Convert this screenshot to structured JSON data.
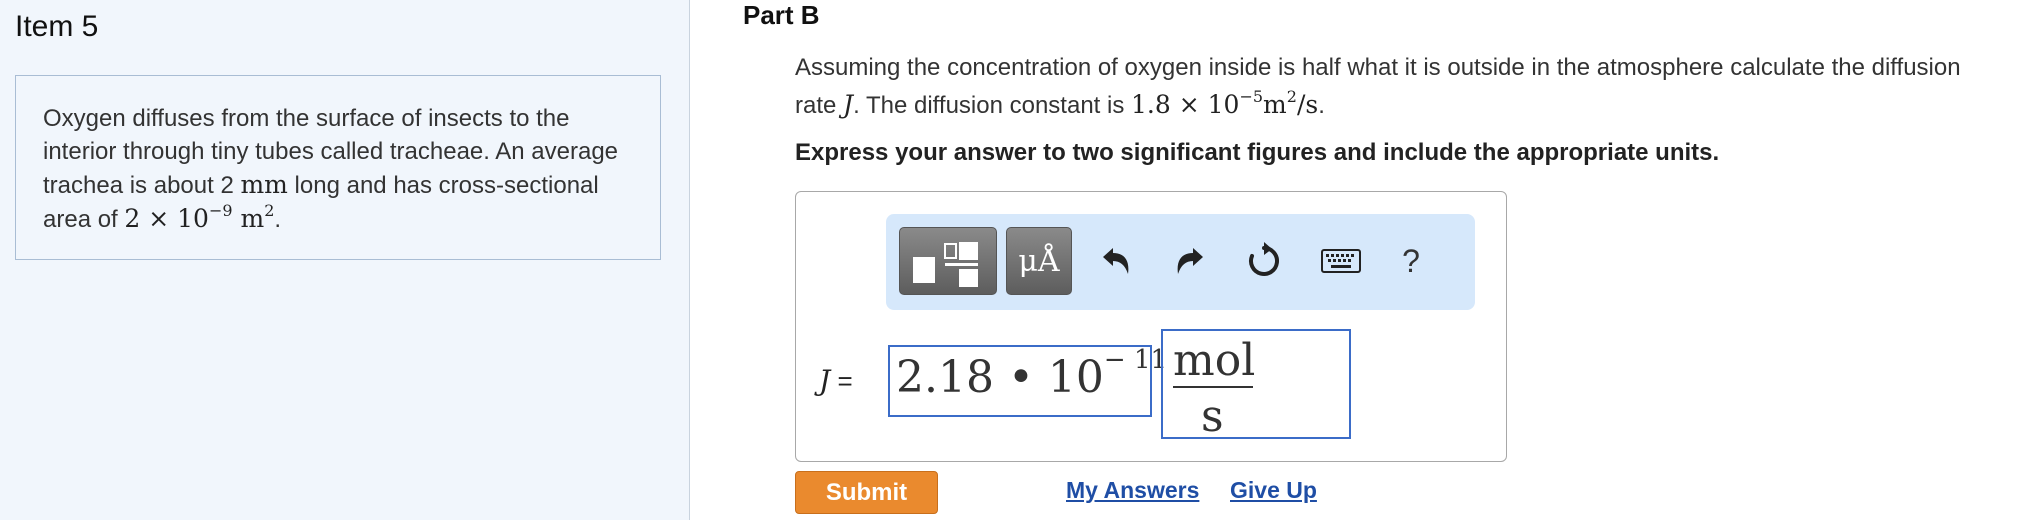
{
  "left": {
    "item_title": "Item 5",
    "problem_text_1": "Oxygen diffuses from the surface of insects to the interior through tiny tubes called tracheae. An average trachea is about 2 ",
    "problem_unit_mm": "mm",
    "problem_text_2": " long and has cross-sectional area of ",
    "problem_area_base": "2 × 10",
    "problem_area_exp": "−9",
    "problem_area_unit": " m",
    "problem_area_unit_exp": "2",
    "problem_text_end": "."
  },
  "part": {
    "title": "Part B",
    "question_text_1": "Assuming the concentration of oxygen inside is half what it is outside in the atmosphere calculate the diffusion rate ",
    "question_var": "J",
    "question_text_2": ". The diffusion constant is ",
    "question_const_base": "1.8 × 10",
    "question_const_exp": "−5",
    "question_const_unit": "m",
    "question_const_unit_exp": "2",
    "question_const_unit_tail": "/s",
    "question_text_end": ".",
    "instruction": "Express your answer to two significant figures and include the appropriate units."
  },
  "toolbar": {
    "templates_icon": "templates-icon",
    "units_label": "μÅ",
    "undo_icon": "undo-icon",
    "redo_icon": "redo-icon",
    "reset_icon": "reset-icon",
    "keyboard_icon": "keyboard-icon",
    "help_label": "?"
  },
  "answer": {
    "var_label": "J",
    "equals": " =",
    "value_mantissa": "2.18 • 10",
    "value_exponent": "− 11",
    "unit_numerator": "mol",
    "unit_denominator": "s"
  },
  "actions": {
    "submit": "Submit",
    "my_answers": "My Answers",
    "give_up": "Give Up"
  },
  "colors": {
    "accent": "#ea8a2e",
    "link": "#1f4ea5",
    "field_border": "#3b6cc8",
    "toolbar_bg": "#d6e8fb",
    "left_panel_bg": "#f1f6fc"
  }
}
